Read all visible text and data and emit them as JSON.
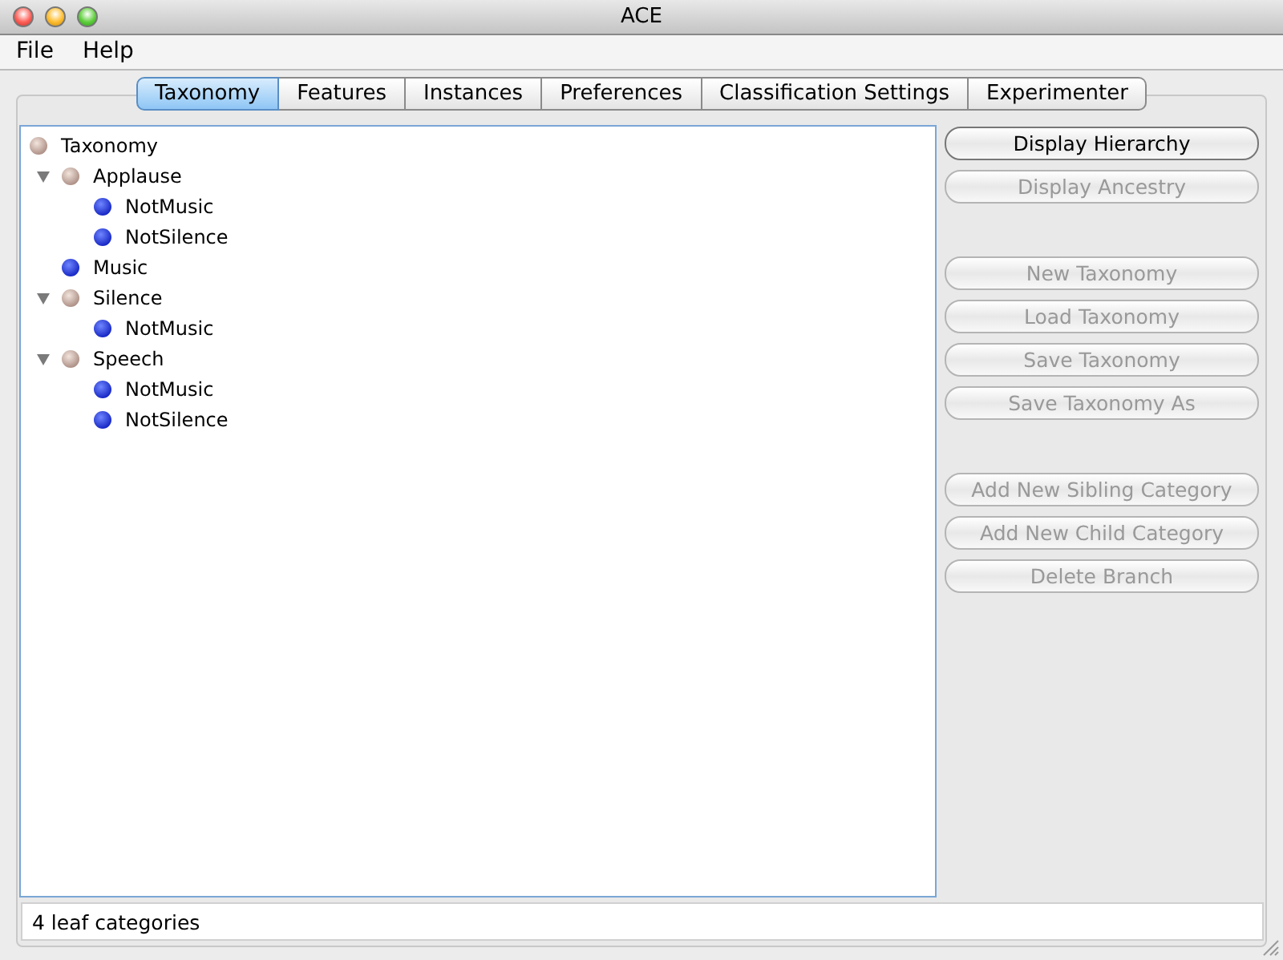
{
  "window": {
    "title": "ACE"
  },
  "menu": [
    "File",
    "Help"
  ],
  "tabs": [
    {
      "label": "Taxonomy",
      "selected": true
    },
    {
      "label": "Features",
      "selected": false
    },
    {
      "label": "Instances",
      "selected": false
    },
    {
      "label": "Preferences",
      "selected": false
    },
    {
      "label": "Classification Settings",
      "selected": false
    },
    {
      "label": "Experimenter",
      "selected": false
    }
  ],
  "tree": [
    {
      "label": "Taxonomy",
      "kind": "branch",
      "children": [
        {
          "label": "Applause",
          "kind": "branch",
          "expanded": true,
          "children": [
            {
              "label": "NotMusic",
              "kind": "leaf"
            },
            {
              "label": "NotSilence",
              "kind": "leaf"
            }
          ]
        },
        {
          "label": "Music",
          "kind": "leaf"
        },
        {
          "label": "Silence",
          "kind": "branch",
          "expanded": true,
          "children": [
            {
              "label": "NotMusic",
              "kind": "leaf"
            }
          ]
        },
        {
          "label": "Speech",
          "kind": "branch",
          "expanded": true,
          "children": [
            {
              "label": "NotMusic",
              "kind": "leaf"
            },
            {
              "label": "NotSilence",
              "kind": "leaf"
            }
          ]
        }
      ]
    }
  ],
  "button_groups": [
    [
      {
        "label": "Display Hierarchy",
        "disabled": false
      },
      {
        "label": "Display Ancestry",
        "disabled": true
      }
    ],
    [
      {
        "label": "New Taxonomy",
        "disabled": true
      },
      {
        "label": "Load Taxonomy",
        "disabled": true
      },
      {
        "label": "Save Taxonomy",
        "disabled": true
      },
      {
        "label": "Save Taxonomy As",
        "disabled": true
      }
    ],
    [
      {
        "label": "Add New Sibling Category",
        "disabled": true
      },
      {
        "label": "Add New Child Category",
        "disabled": true
      },
      {
        "label": "Delete Branch",
        "disabled": true
      }
    ]
  ],
  "status": {
    "value": "4 leaf categories"
  }
}
